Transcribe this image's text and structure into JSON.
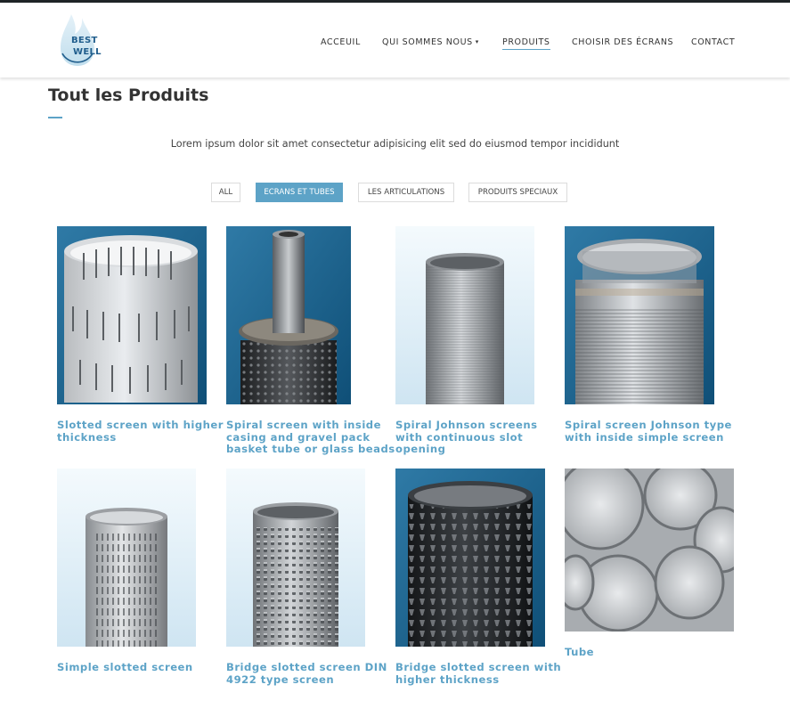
{
  "logo": {
    "line1": "BEST",
    "line2": "WELL"
  },
  "nav": {
    "items": [
      {
        "label": "ACCEUIL"
      },
      {
        "label": "QUI SOMMES NOUS",
        "caret": "▾"
      },
      {
        "label": "PRODUITS",
        "active": true
      },
      {
        "label": "CHOISIR DES ÉCRANS"
      },
      {
        "label": "CONTACT"
      }
    ]
  },
  "page": {
    "title": "Tout les Produits",
    "intro": "Lorem ipsum dolor sit amet consectetur adipisicing elit sed do eiusmod tempor incididunt"
  },
  "filters": [
    {
      "label": "ALL"
    },
    {
      "label": "ECRANS ET TUBES",
      "active": true
    },
    {
      "label": "LES ARTICULATIONS"
    },
    {
      "label": "PRODUITS SPECIAUX"
    }
  ],
  "accent_color": "#5da3c7",
  "products": [
    {
      "caption": "Slotted screen with higher thickness",
      "icon": "slotted-screen-image"
    },
    {
      "caption": "Spiral screen with inside casing and gravel pack basket tube or glass beads",
      "icon": "gravel-pack-screen-image"
    },
    {
      "caption": "Spiral Johnson screens with continuous slot opening",
      "icon": "johnson-screen-image"
    },
    {
      "caption": "Spiral screen Johnson type with inside simple screen",
      "icon": "johnson-inside-screen-image"
    },
    {
      "caption": "Simple slotted screen",
      "icon": "simple-slotted-screen-image"
    },
    {
      "caption": "Bridge slotted screen DIN 4922 type screen",
      "icon": "bridge-slotted-screen-image"
    },
    {
      "caption": "Bridge slotted screen with higher thickness",
      "icon": "bridge-thick-screen-image"
    },
    {
      "caption": "Tube",
      "icon": "tube-stack-image"
    }
  ]
}
